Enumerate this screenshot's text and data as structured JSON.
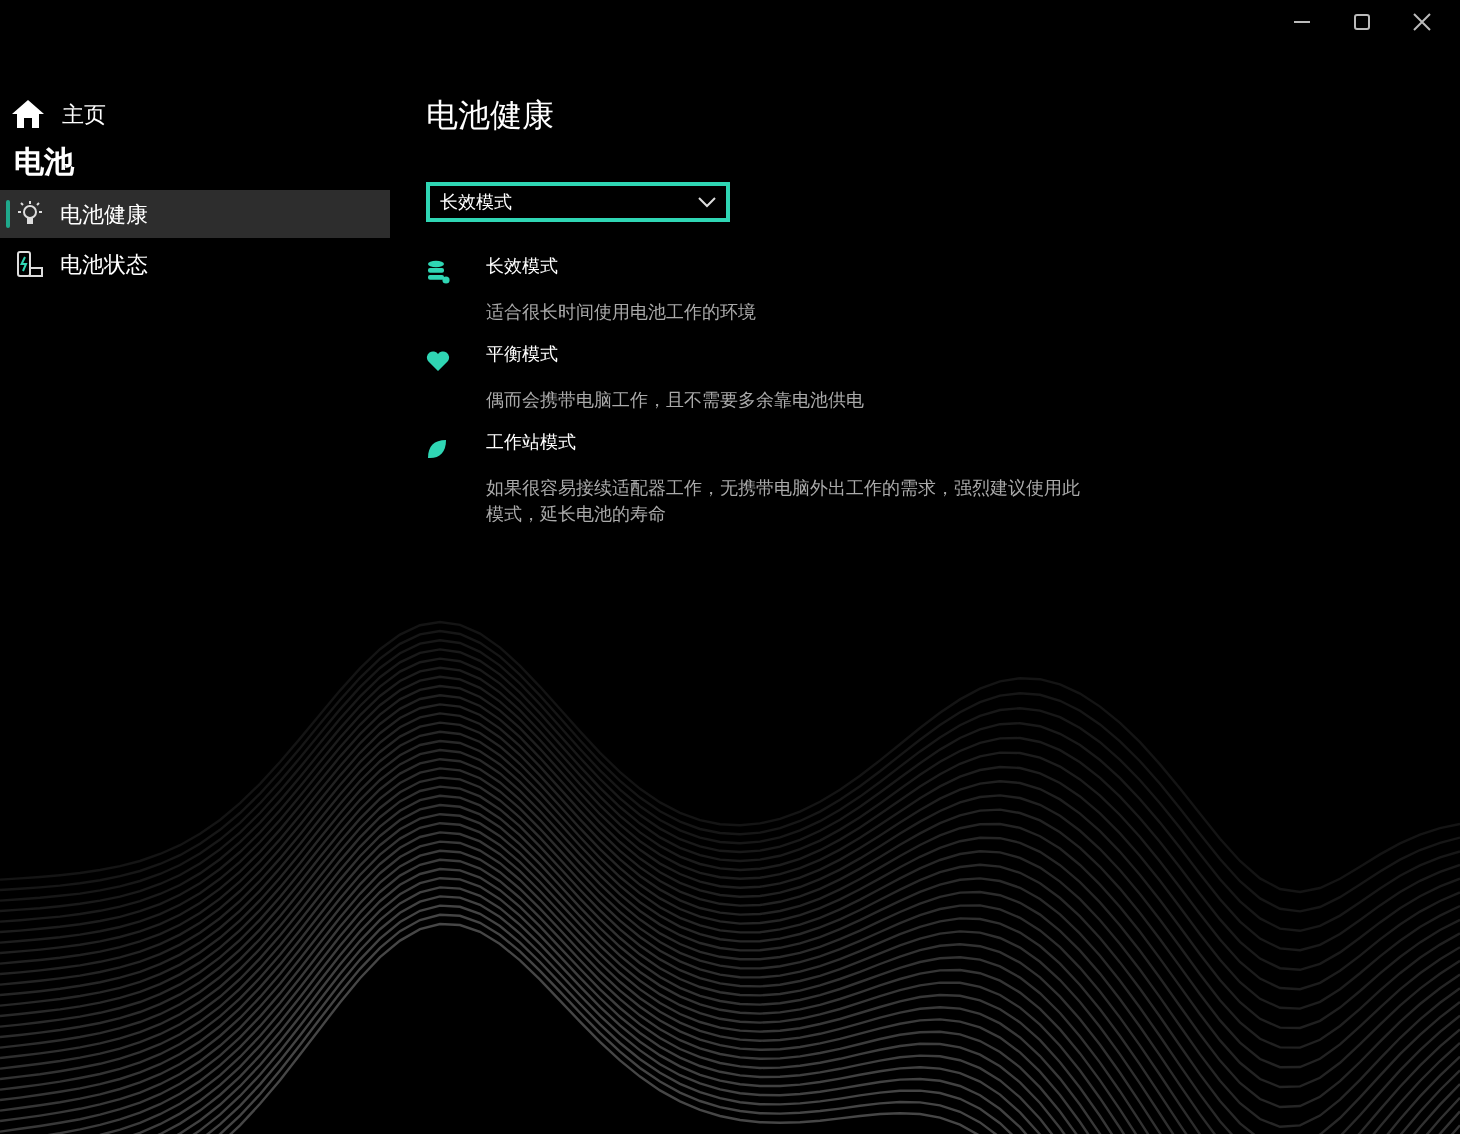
{
  "home": {
    "label": "主页"
  },
  "section_title": "电池",
  "nav_items": [
    {
      "label": "电池健康",
      "kind": "bulb",
      "selected": true
    },
    {
      "label": "电池状态",
      "kind": "battery",
      "selected": false
    }
  ],
  "page_title": "电池健康",
  "mode_select": {
    "value": "长效模式"
  },
  "modes": [
    {
      "kind": "database",
      "title": "长效模式",
      "description": "适合很长时间使用电池工作的环境"
    },
    {
      "kind": "heart",
      "title": "平衡模式",
      "description": "偶而会携带电脑工作，且不需要多余靠电池供电"
    },
    {
      "kind": "leaf",
      "title": "工作站模式",
      "description": "如果很容易接续适配器工作，无携带电脑外出工作的需求，强烈建议使用此模式，延长电池的寿命"
    }
  ]
}
